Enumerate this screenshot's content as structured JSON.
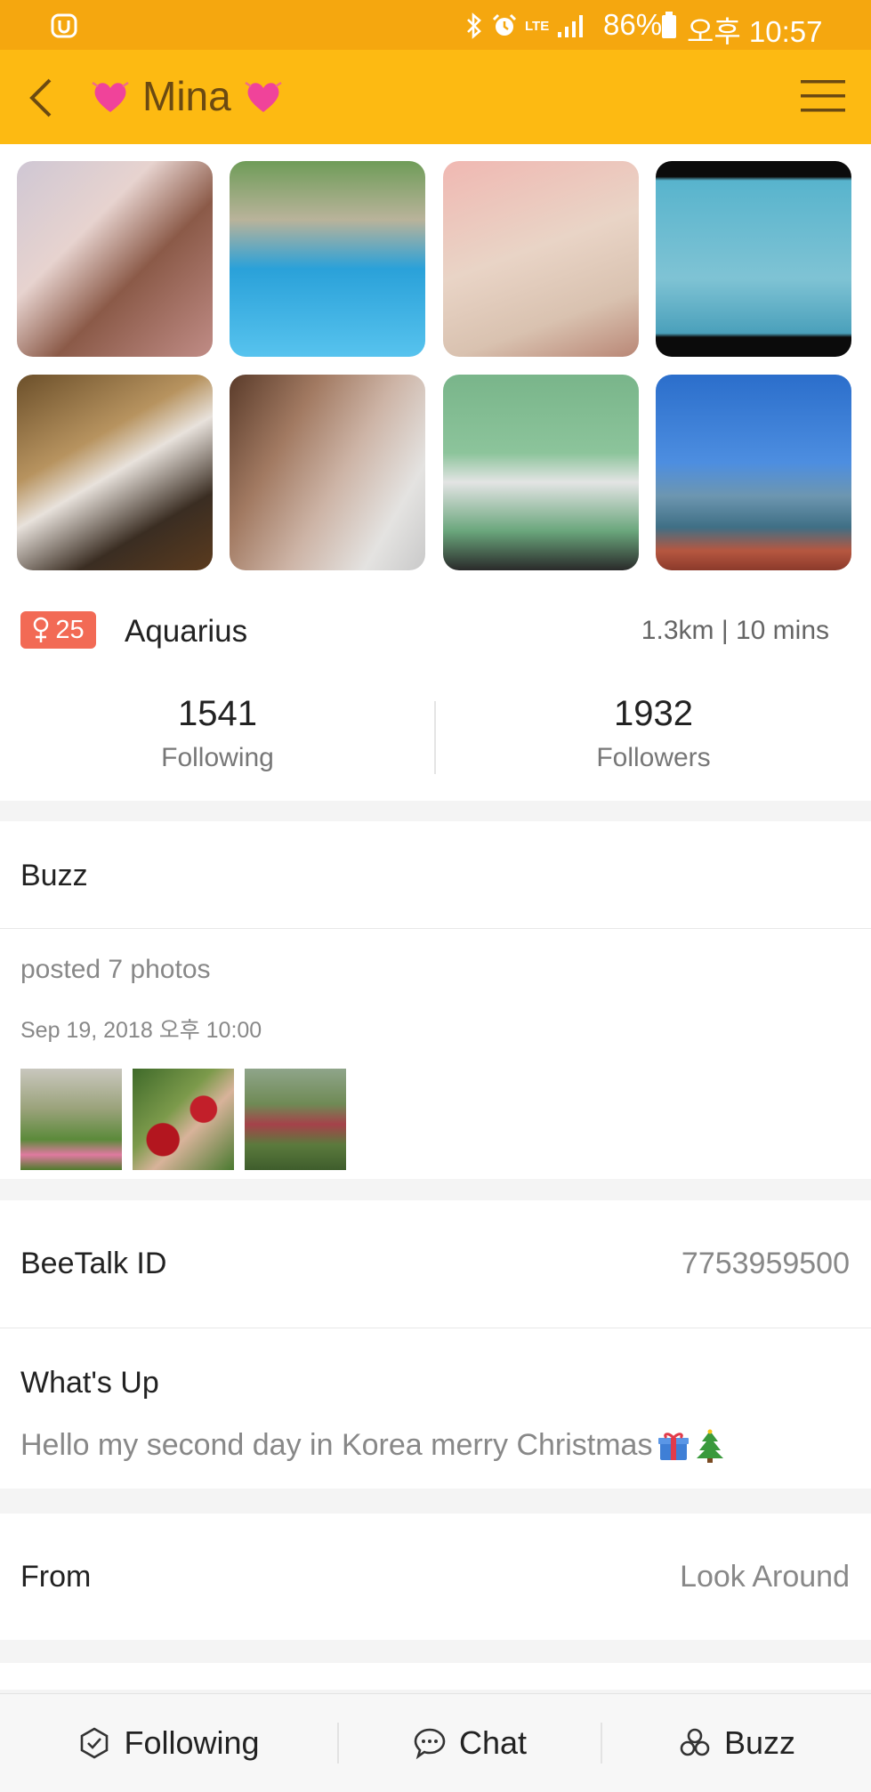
{
  "status_bar": {
    "battery_percent": "86%",
    "time": "오후 10:57",
    "lte": "LTE"
  },
  "header": {
    "title": "Mina"
  },
  "gallery": {
    "photo_count_shown": 8
  },
  "profile": {
    "age": "25",
    "zodiac": "Aquarius",
    "distance_time": "1.3km | 10 mins",
    "following_count": "1541",
    "following_label": "Following",
    "followers_count": "1932",
    "followers_label": "Followers"
  },
  "buzz": {
    "label": "Buzz",
    "post_text": "posted 7 photos",
    "post_date": "Sep 19, 2018 오후 10:00"
  },
  "details": {
    "id_label": "BeeTalk ID",
    "id_value": "7753959500",
    "whats_up_label": "What's Up",
    "whats_up_text": "Hello my second day in Korea merry Christmas",
    "from_label": "From",
    "from_value": "Look Around"
  },
  "bottom_bar": {
    "following_label": "Following",
    "chat_label": "Chat",
    "buzz_label": "Buzz"
  },
  "colors": {
    "status_bar": "#f5a70f",
    "header": "#fdba12",
    "age_badge": "#f26a55"
  }
}
